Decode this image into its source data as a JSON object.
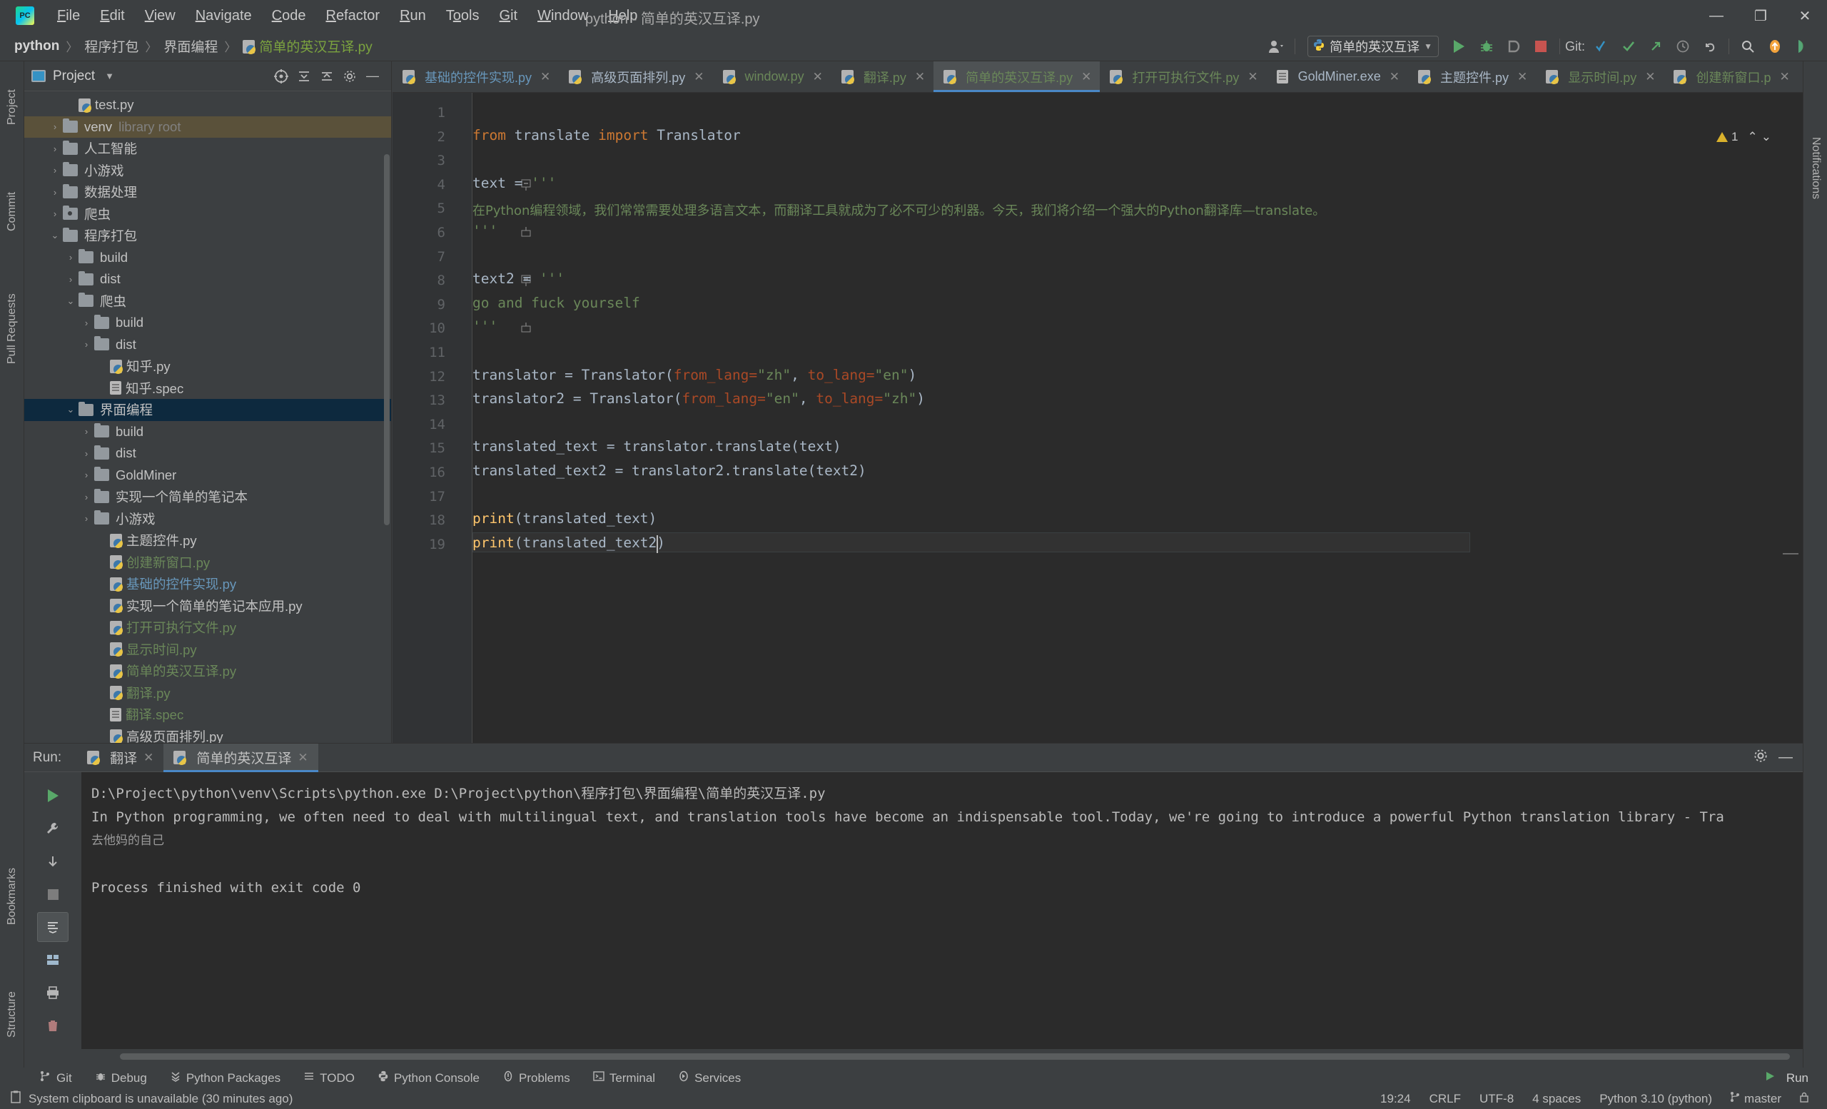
{
  "titlebar": {
    "logo": "pycharm-logo",
    "menus": [
      "File",
      "Edit",
      "View",
      "Navigate",
      "Code",
      "Refactor",
      "Run",
      "Tools",
      "Git",
      "Window",
      "Help"
    ],
    "window_title": "python - 简单的英汉互译.py",
    "minimize": "—",
    "maximize": "❐",
    "close": "✕"
  },
  "navbar": {
    "breadcrumb": [
      "python",
      "程序打包",
      "界面编程",
      "简单的英汉互译.py"
    ],
    "separator": "〉",
    "run_config": "简单的英汉互译",
    "git_label": "Git:",
    "icons": [
      "avatar-icon",
      "run-icon",
      "debug-icon",
      "coverage-icon",
      "stop-icon",
      "git-update-icon",
      "git-commit-icon",
      "git-push-icon",
      "history-icon",
      "undo-icon",
      "search-icon",
      "updates-icon",
      "ide-icon"
    ]
  },
  "left_strip": {
    "top": [
      "Project"
    ],
    "middle": [
      "Commit",
      "Pull Requests"
    ],
    "bottom": [
      "Bookmarks",
      "Structure"
    ]
  },
  "project": {
    "title": "Project",
    "tree": [
      {
        "indent": 2,
        "type": "py",
        "label": "test.py",
        "color": "",
        "arrow": ""
      },
      {
        "indent": 1,
        "type": "folder",
        "label": "venv",
        "suffix": "library root",
        "color": "",
        "arrow": "›",
        "state": "sel-inactive"
      },
      {
        "indent": 1,
        "type": "folder",
        "label": "人工智能",
        "color": "",
        "arrow": "›"
      },
      {
        "indent": 1,
        "type": "folder",
        "label": "小游戏",
        "color": "",
        "arrow": "›"
      },
      {
        "indent": 1,
        "type": "folder",
        "label": "数据处理",
        "color": "",
        "arrow": "›"
      },
      {
        "indent": 1,
        "type": "folder-dot",
        "label": "爬虫",
        "color": "",
        "arrow": "›"
      },
      {
        "indent": 1,
        "type": "folder",
        "label": "程序打包",
        "color": "",
        "arrow": "⌄"
      },
      {
        "indent": 2,
        "type": "folder",
        "label": "build",
        "color": "",
        "arrow": "›"
      },
      {
        "indent": 2,
        "type": "folder",
        "label": "dist",
        "color": "",
        "arrow": "›"
      },
      {
        "indent": 2,
        "type": "folder",
        "label": "爬虫",
        "color": "",
        "arrow": "⌄"
      },
      {
        "indent": 3,
        "type": "folder",
        "label": "build",
        "color": "",
        "arrow": "›"
      },
      {
        "indent": 3,
        "type": "folder",
        "label": "dist",
        "color": "",
        "arrow": "›"
      },
      {
        "indent": 4,
        "type": "py",
        "label": "知乎.py",
        "color": ""
      },
      {
        "indent": 4,
        "type": "spec",
        "label": "知乎.spec",
        "color": ""
      },
      {
        "indent": 2,
        "type": "folder",
        "label": "界面编程",
        "color": "",
        "arrow": "⌄",
        "state": "sel-active"
      },
      {
        "indent": 3,
        "type": "folder",
        "label": "build",
        "color": "",
        "arrow": "›"
      },
      {
        "indent": 3,
        "type": "folder",
        "label": "dist",
        "color": "",
        "arrow": "›"
      },
      {
        "indent": 3,
        "type": "folder",
        "label": "GoldMiner",
        "color": "",
        "arrow": "›"
      },
      {
        "indent": 3,
        "type": "folder",
        "label": "实现一个简单的笔记本",
        "color": "",
        "arrow": "›"
      },
      {
        "indent": 3,
        "type": "folder",
        "label": "小游戏",
        "color": "",
        "arrow": "›"
      },
      {
        "indent": 4,
        "type": "py",
        "label": "主题控件.py",
        "color": ""
      },
      {
        "indent": 4,
        "type": "py",
        "label": "创建新窗口.py",
        "color": "green"
      },
      {
        "indent": 4,
        "type": "py",
        "label": "基础的控件实现.py",
        "color": "blue"
      },
      {
        "indent": 4,
        "type": "py",
        "label": "实现一个简单的笔记本应用.py",
        "color": ""
      },
      {
        "indent": 4,
        "type": "py",
        "label": "打开可执行文件.py",
        "color": "green"
      },
      {
        "indent": 4,
        "type": "py",
        "label": "显示时间.py",
        "color": "green"
      },
      {
        "indent": 4,
        "type": "py",
        "label": "简单的英汉互译.py",
        "color": "green"
      },
      {
        "indent": 4,
        "type": "py",
        "label": "翻译.py",
        "color": "green"
      },
      {
        "indent": 4,
        "type": "spec",
        "label": "翻译.spec",
        "color": "green"
      },
      {
        "indent": 4,
        "type": "py",
        "label": "高级页面排列.py",
        "color": ""
      }
    ]
  },
  "editor": {
    "tabs": [
      {
        "label": "基础的控件实现.py",
        "color": "blue",
        "icon": "py-file-icon",
        "active": false
      },
      {
        "label": "高级页面排列.py",
        "color": "grey",
        "icon": "py-file-icon",
        "active": false
      },
      {
        "label": "window.py",
        "color": "green",
        "icon": "py-file-icon",
        "active": false
      },
      {
        "label": "翻译.py",
        "color": "green",
        "icon": "py-file-icon",
        "active": false
      },
      {
        "label": "简单的英汉互译.py",
        "color": "green",
        "icon": "py-file-icon",
        "active": true
      },
      {
        "label": "打开可执行文件.py",
        "color": "green",
        "icon": "py-file-icon",
        "active": false
      },
      {
        "label": "GoldMiner.exe",
        "color": "grey",
        "icon": "spec-file-icon",
        "active": false
      },
      {
        "label": "主题控件.py",
        "color": "grey",
        "icon": "py-file-icon",
        "active": false
      },
      {
        "label": "显示时间.py",
        "color": "green",
        "icon": "py-file-icon",
        "active": false
      },
      {
        "label": "创建新窗口.p",
        "color": "green",
        "icon": "py-file-icon",
        "active": false
      }
    ],
    "tab_close": "✕",
    "tab_overflow": "⌄",
    "tab_more": "⋮",
    "warning_count": "1",
    "inspection_up": "⌃",
    "inspection_down": "⌄",
    "line_numbers": [
      "1",
      "2",
      "3",
      "4",
      "5",
      "6",
      "7",
      "8",
      "9",
      "10",
      "11",
      "12",
      "13",
      "14",
      "15",
      "16",
      "17",
      "18",
      "19"
    ],
    "code": [
      {
        "n": 1,
        "parts": []
      },
      {
        "n": 2,
        "parts": [
          {
            "t": "from ",
            "c": "k-kw"
          },
          {
            "t": "translate ",
            "c": ""
          },
          {
            "t": "import ",
            "c": "k-kw"
          },
          {
            "t": "Translator",
            "c": ""
          }
        ]
      },
      {
        "n": 3,
        "parts": []
      },
      {
        "n": 4,
        "parts": [
          {
            "t": "text = ",
            "c": ""
          },
          {
            "t": "'''",
            "c": "k-str"
          }
        ],
        "fold": "minus"
      },
      {
        "n": 5,
        "parts": [
          {
            "t": "在Python编程领域，我们常常需要处理多语言文本，而翻译工具就成为了必不可少的利器。今天，我们将介绍一个强大的Python翻译库—translate。",
            "c": "k-str"
          }
        ],
        "cjk": true
      },
      {
        "n": 6,
        "parts": [
          {
            "t": "'''",
            "c": "k-str"
          }
        ],
        "fold": "end"
      },
      {
        "n": 7,
        "parts": []
      },
      {
        "n": 8,
        "parts": [
          {
            "t": "text2 = ",
            "c": ""
          },
          {
            "t": "'''",
            "c": "k-str"
          }
        ],
        "fold": "minus"
      },
      {
        "n": 9,
        "parts": [
          {
            "t": "go and fuck yourself",
            "c": "k-str"
          }
        ]
      },
      {
        "n": 10,
        "parts": [
          {
            "t": "'''",
            "c": "k-str"
          }
        ],
        "fold": "end"
      },
      {
        "n": 11,
        "parts": []
      },
      {
        "n": 12,
        "parts": [
          {
            "t": "translator = Translator(",
            "c": ""
          },
          {
            "t": "from_lang=",
            "c": "k-param"
          },
          {
            "t": "\"zh\"",
            "c": "k-str"
          },
          {
            "t": ", ",
            "c": ""
          },
          {
            "t": "to_lang=",
            "c": "k-param"
          },
          {
            "t": "\"en\"",
            "c": "k-str"
          },
          {
            "t": ")",
            "c": ""
          }
        ]
      },
      {
        "n": 13,
        "parts": [
          {
            "t": "translator2 = Translator(",
            "c": ""
          },
          {
            "t": "from_lang=",
            "c": "k-param"
          },
          {
            "t": "\"en\"",
            "c": "k-str"
          },
          {
            "t": ", ",
            "c": ""
          },
          {
            "t": "to_lang=",
            "c": "k-param"
          },
          {
            "t": "\"zh\"",
            "c": "k-str"
          },
          {
            "t": ")",
            "c": ""
          }
        ]
      },
      {
        "n": 14,
        "parts": []
      },
      {
        "n": 15,
        "parts": [
          {
            "t": "translated_text = translator.translate(text)",
            "c": ""
          }
        ]
      },
      {
        "n": 16,
        "parts": [
          {
            "t": "translated_text2 = translator2.translate(text2)",
            "c": ""
          }
        ]
      },
      {
        "n": 17,
        "parts": []
      },
      {
        "n": 18,
        "parts": [
          {
            "t": "print",
            "c": "k-fn"
          },
          {
            "t": "(translated_text)",
            "c": ""
          }
        ]
      },
      {
        "n": 19,
        "parts": [
          {
            "t": "print",
            "c": "k-fn"
          },
          {
            "t": "(translated_text2)",
            "c": ""
          }
        ]
      }
    ]
  },
  "run_panel": {
    "label": "Run:",
    "tabs": [
      {
        "label": "翻译",
        "active": false
      },
      {
        "label": "简单的英汉互译",
        "active": true
      }
    ],
    "close": "✕",
    "settings_icon": "gear-icon",
    "minimize_icon": "minimize-icon",
    "side_buttons": [
      "rerun-icon",
      "wrench-icon",
      "down-arrow-icon",
      "stop-icon",
      "scroll-end-icon",
      "layout-icon",
      "print-icon",
      "trash-icon"
    ],
    "console": [
      {
        "text": "D:\\Project\\python\\venv\\Scripts\\python.exe D:\\Project\\python\\程序打包\\界面编程\\简单的英汉互译.py",
        "cjk": false
      },
      {
        "text": "In Python programming, we often need to deal with multilingual text, and translation tools have become an indispensable tool.Today, we're going to introduce a powerful Python translation library - Tra",
        "cjk": false
      },
      {
        "text": "去他妈的自己",
        "cjk": true
      },
      {
        "text": "",
        "cjk": false
      },
      {
        "text": "Process finished with exit code 0",
        "cjk": false
      }
    ]
  },
  "toolwindow_bar": {
    "items": [
      {
        "label": "Git",
        "icon": "git-branch-icon"
      },
      {
        "label": "Debug",
        "icon": "debug-bug-icon"
      },
      {
        "label": "Python Packages",
        "icon": "packages-icon"
      },
      {
        "label": "TODO",
        "icon": "todo-list-icon"
      },
      {
        "label": "Python Console",
        "icon": "python-icon"
      },
      {
        "label": "Problems",
        "icon": "problems-icon"
      },
      {
        "label": "Terminal",
        "icon": "terminal-icon"
      },
      {
        "label": "Services",
        "icon": "services-icon"
      }
    ]
  },
  "statusbar": {
    "message": "System clipboard is unavailable (30 minutes ago)",
    "message_icon": "clipboard-icon",
    "caret_position": "19:24",
    "line_separator": "CRLF",
    "encoding": "UTF-8",
    "indent": "4 spaces",
    "interpreter": "Python 3.10 (python)",
    "branch": "master",
    "run_widget": "Run",
    "lock_icon": "lock-icon",
    "branch_icon": "git-branch-icon",
    "run_icon": "run-triangle-icon"
  },
  "right_strip": {
    "items": [
      "Notifications"
    ]
  },
  "colors": {
    "accent_blue": "#4a88c7",
    "string_green": "#6a8759",
    "keyword_orange": "#cc7832",
    "param_orange": "#aa4926",
    "function_yellow": "#ffc66d",
    "panel_bg": "#3c3f41",
    "editor_bg": "#2b2b2b",
    "selection_active": "#0d293e",
    "selection_inactive": "#5a513a",
    "run_green": "#59a869",
    "stop_red": "#c75450"
  }
}
